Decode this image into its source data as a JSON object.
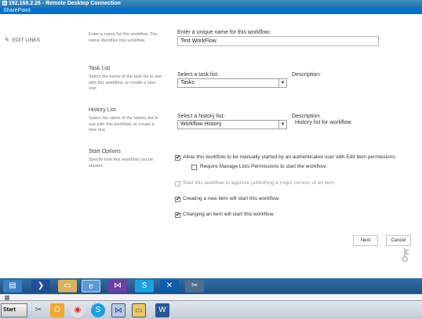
{
  "window": {
    "title": "192.168.2.26 - Remote Desktop Connection",
    "app_header": "SharePoint",
    "user_menu": ""
  },
  "nav": {
    "edit_links": "EDIT LINKS"
  },
  "name_section": {
    "description": "Enter a name for this workflow. The name identifies this workflow.",
    "field_label": "Enter a unique name for this workflow:",
    "value": "Test WorkFlow"
  },
  "task_section": {
    "title": "Task List",
    "description": "Select the name of the task list to use with this workflow, or create a new one.",
    "field_label": "Select a task list:",
    "selected": "Tasks",
    "description_label": "Description:",
    "description_value": ""
  },
  "history_section": {
    "title": "History List",
    "description": "Select the name of the history list to use with this workflow, or create a new one.",
    "field_label": "Select a history list:",
    "selected": "Workflow History",
    "description_label": "Description:",
    "description_value": "History list for workflow."
  },
  "start_section": {
    "title": "Start Options",
    "description": "Specify how this workflow can be started.",
    "options": [
      {
        "label": "Allow this workflow to be manually started by an authenticated user with Edit Item permissions.",
        "checked": true,
        "disabled": false
      },
      {
        "label": "Require Manage Lists Permissions to start the workflow.",
        "checked": false,
        "disabled": false
      },
      {
        "label": "Start this workflow to approve publishing a major version of an item.",
        "checked": false,
        "disabled": true
      },
      {
        "label": "Creating a new item will start this workflow.",
        "checked": true,
        "disabled": false
      },
      {
        "label": "Changing an item will start this workflow.",
        "checked": true,
        "disabled": false
      }
    ]
  },
  "buttons": {
    "next": "Next",
    "cancel": "Cancel"
  },
  "taskbar": {
    "start": "Start"
  },
  "icons": {
    "top": [
      "server-manager-icon",
      "powershell-icon",
      "explorer-icon",
      "ie-icon",
      "visual-studio-icon",
      "skype-icon",
      "sharepoint-designer-icon",
      "tools-icon"
    ],
    "bottom": [
      "tools-icon",
      "outlook-icon",
      "chrome-icon",
      "skype-icon",
      "visual-studio-icon",
      "explorer-icon",
      "word-icon"
    ],
    "check_mark": "✔"
  }
}
